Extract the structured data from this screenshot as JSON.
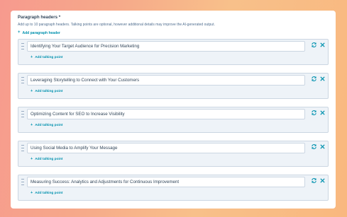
{
  "section": {
    "title": "Paragraph headers *",
    "description": "Add up to 10 paragraph headers. Talking points are optional, however additional details may improve the AI-generated output.",
    "add_header_label": "Add paragraph header"
  },
  "rows": [
    {
      "header": "Identifying Your Target Audience for Precision Marketing",
      "add_point_label": "Add talking point"
    },
    {
      "header": "Leveraging Storytelling to Connect with Your Customers",
      "add_point_label": "Add talking point"
    },
    {
      "header": "Optimizing Content for SEO to Increase Visibility",
      "add_point_label": "Add talking point"
    },
    {
      "header": "Using Social Media to Amplify Your Message",
      "add_point_label": "Add talking point"
    },
    {
      "header": "Measuring Success: Analytics and Adjustments for Continuous Improvement",
      "add_point_label": "Add talking point"
    }
  ],
  "icons": {
    "plus": "+",
    "regenerate": "refresh-icon",
    "remove": "close-icon",
    "drag": "drag-handle-icon"
  },
  "colors": {
    "accent": "#0091ae",
    "text": "#33475b",
    "row_bg": "#eef3f8",
    "border": "#cbd6e2"
  }
}
